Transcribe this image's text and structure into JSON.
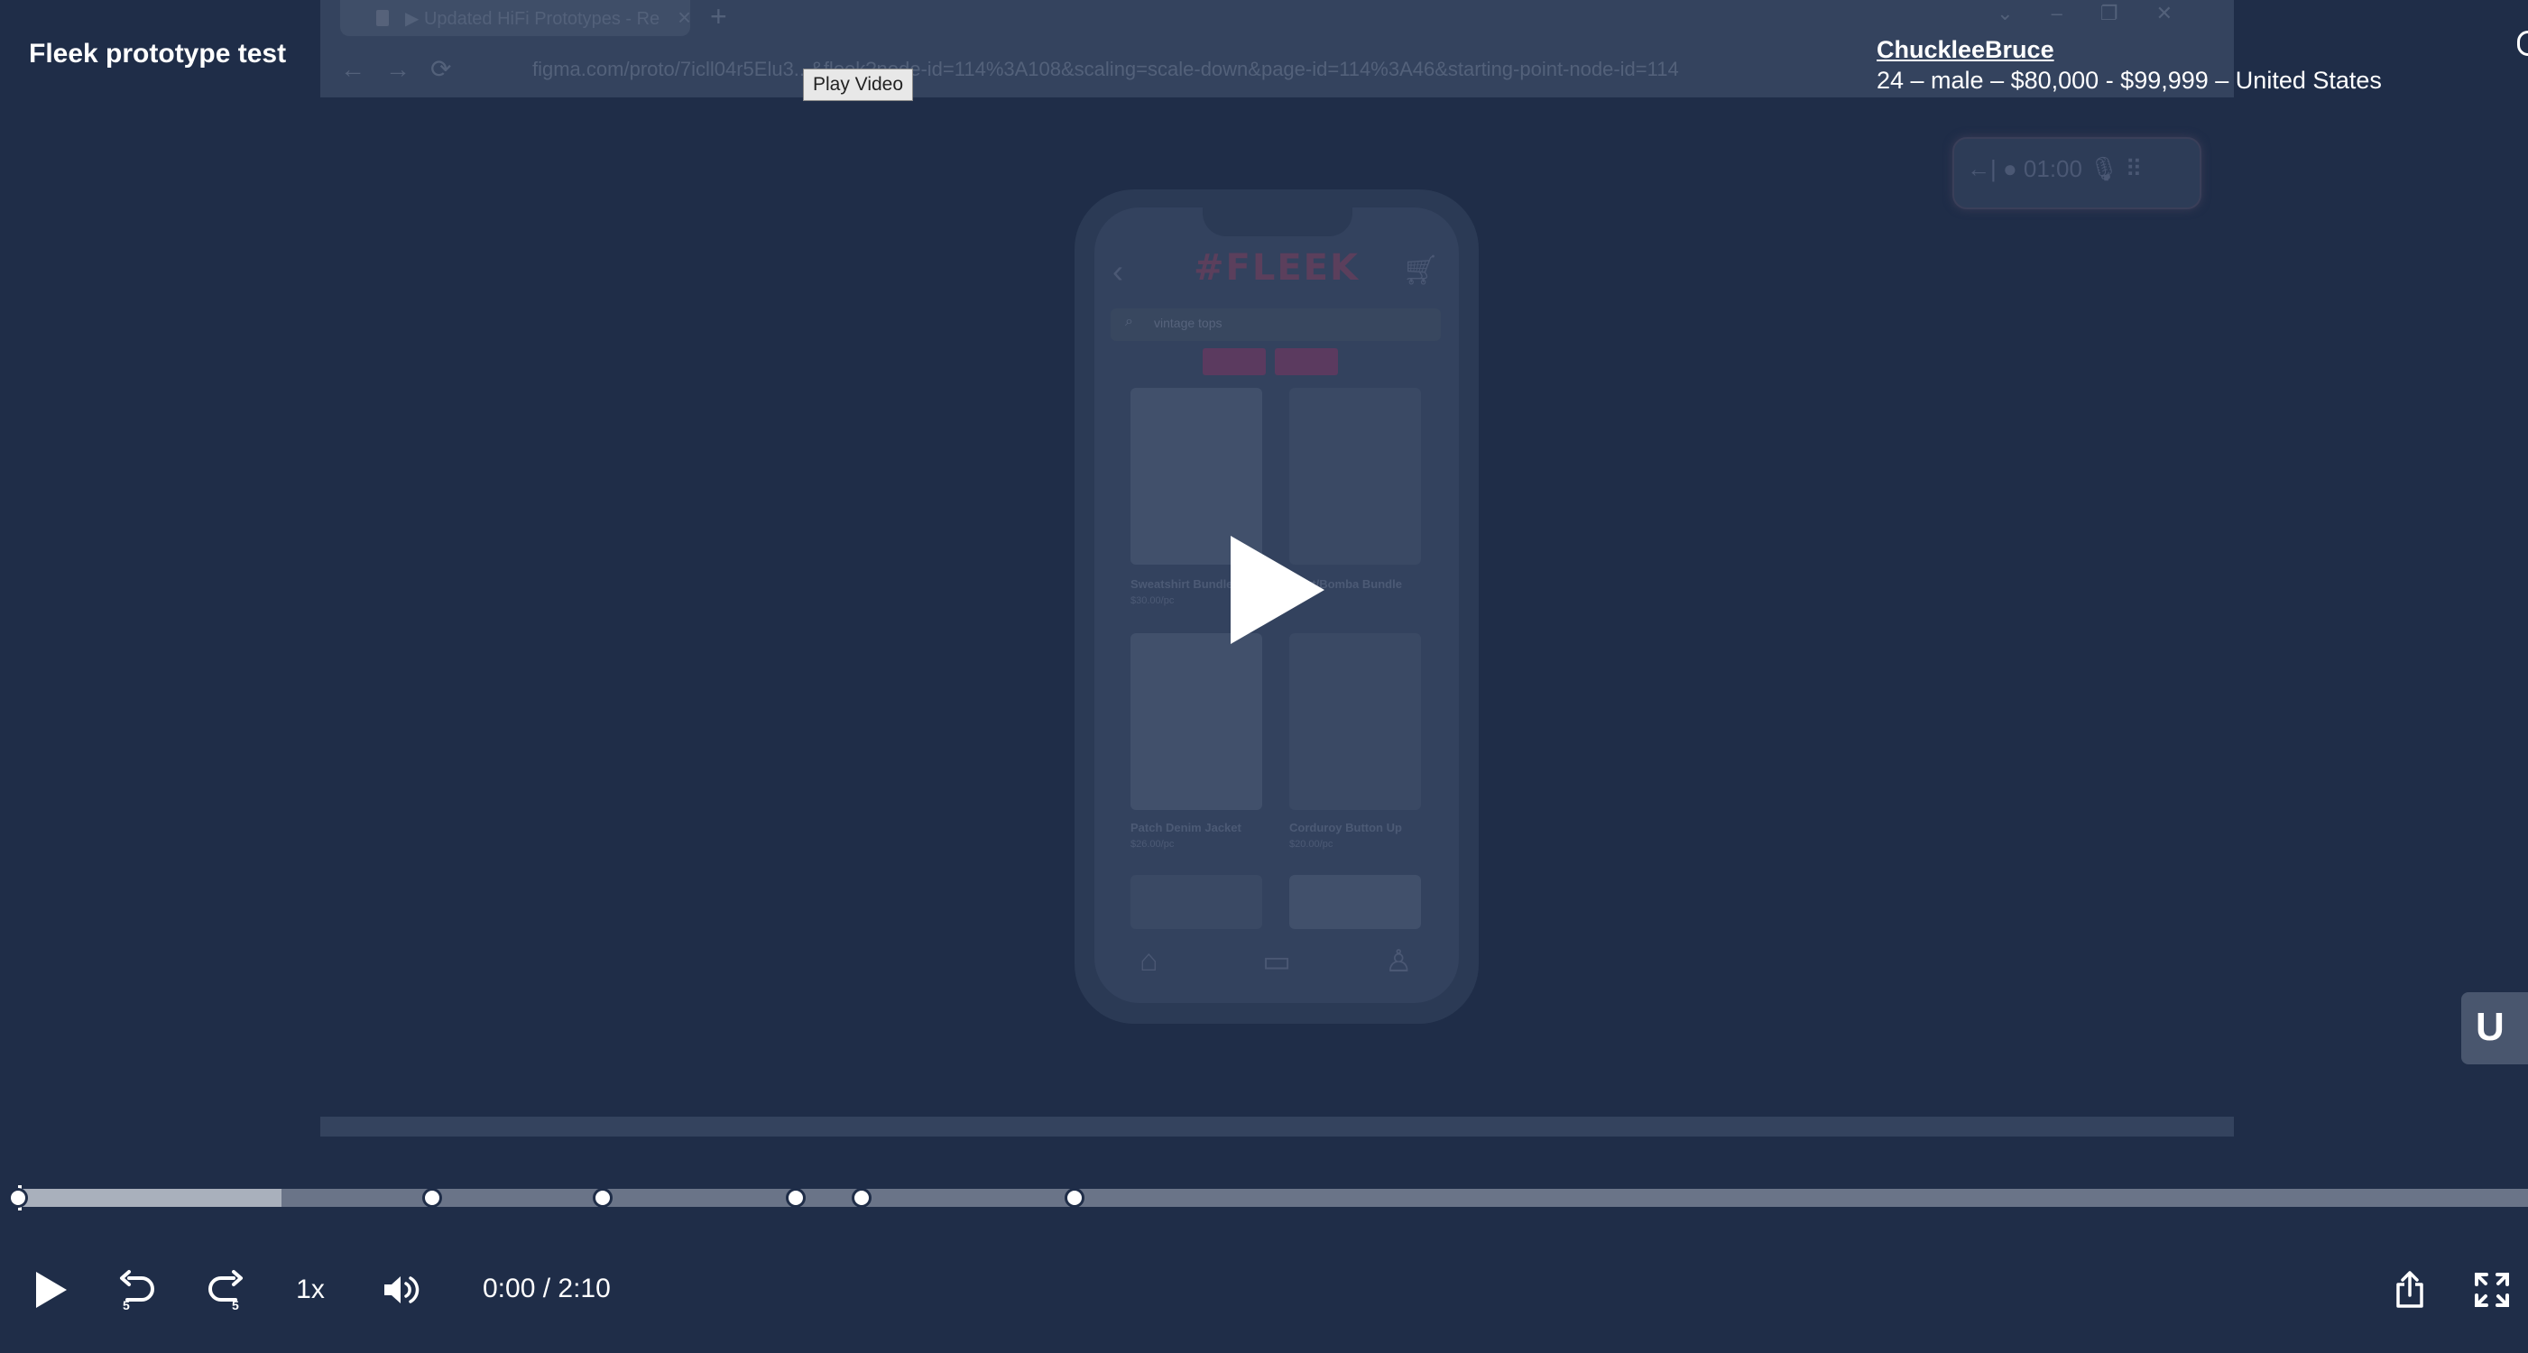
{
  "header": {
    "title": "Fleek prototype test",
    "tooltip": "Play Video"
  },
  "participant": {
    "name": "ChuckleeBruce",
    "details": "24 – male – $80,000 - $99,999 – United States"
  },
  "recorded_screen": {
    "browser_tab_title": "▶ Updated HiFi Prototypes - Re",
    "url": "figma.com/proto/7icll04r5Elu3...&fleek?node-id=114%3A108&scaling=scale-down&page-id=114%3A46&starting-point-node-id=114",
    "app": {
      "logo": "#FLEEK",
      "search_query": "vintage tops",
      "products": [
        {
          "name": "Sweatshirt Bundle",
          "price": "$30.00/pc"
        },
        {
          "name": "Shirt/Bomba Bundle",
          "price": ""
        },
        {
          "name": "Patch Denim Jacket",
          "price": "$26.00/pc"
        },
        {
          "name": "Corduroy Button Up",
          "price": "$20.00/pc"
        }
      ]
    },
    "recorder_timer": "01:00"
  },
  "player": {
    "current_time": "0:00",
    "separator": " / ",
    "duration": "2:10",
    "speed": "1x",
    "skip_back_seconds": "5",
    "skip_forward_seconds": "5",
    "buffered_fraction": 0.105,
    "marker_fractions": [
      0.0,
      0.165,
      0.233,
      0.31,
      0.336,
      0.421
    ]
  },
  "side_widget_label": "U"
}
